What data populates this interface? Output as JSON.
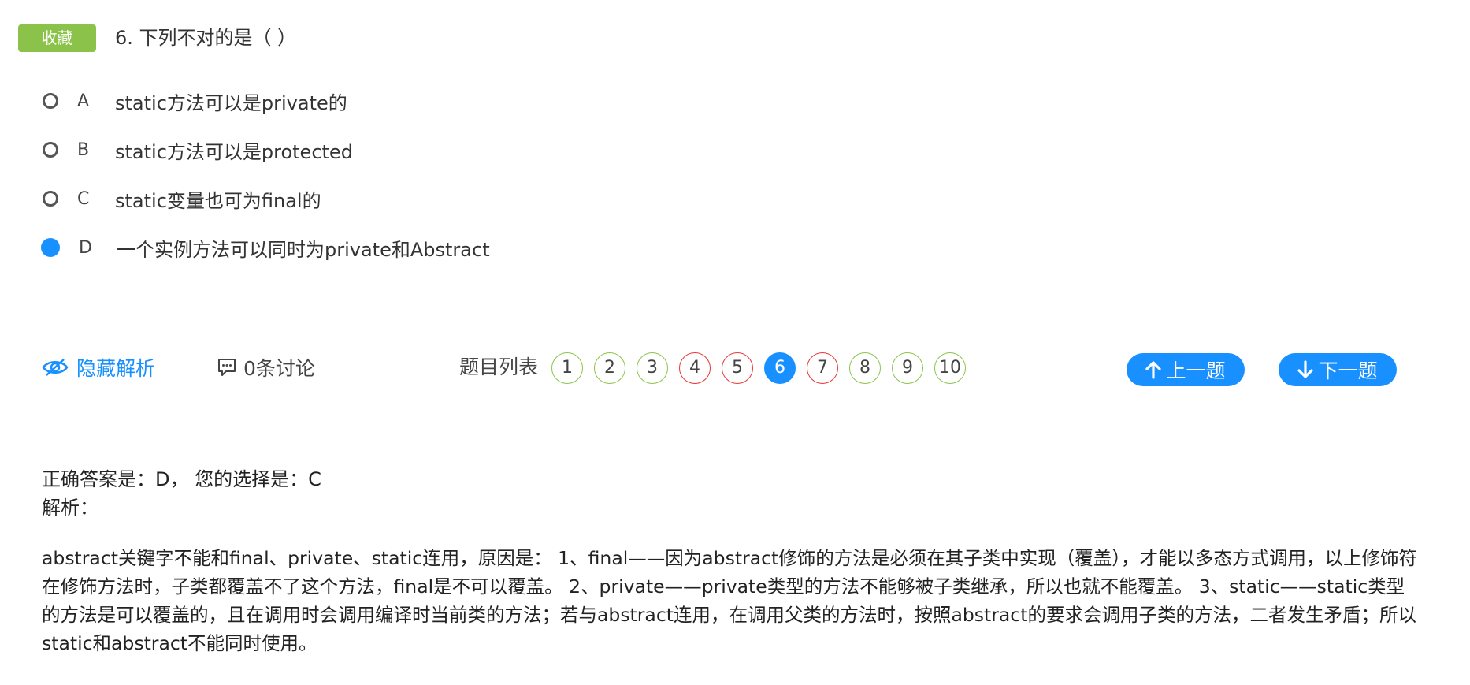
{
  "header": {
    "favorite_label": "收藏",
    "question_title": "6. 下列不对的是（ ）"
  },
  "options": [
    {
      "letter": "A",
      "text": "static方法可以是private的",
      "selected": false
    },
    {
      "letter": "B",
      "text": "static方法可以是protected",
      "selected": false
    },
    {
      "letter": "C",
      "text": "static变量也可为final的",
      "selected": false
    },
    {
      "letter": "D",
      "text": "一个实例方法可以同时为private和Abstract",
      "selected": true
    }
  ],
  "toolbar": {
    "hide_analysis_label": "隐藏解析",
    "discussion_label": "0条讨论",
    "question_list_label": "题目列表",
    "prev_label": "上一题",
    "next_label": "下一题"
  },
  "question_numbers": [
    {
      "num": "1",
      "status": "correct"
    },
    {
      "num": "2",
      "status": "correct"
    },
    {
      "num": "3",
      "status": "correct"
    },
    {
      "num": "4",
      "status": "wrong"
    },
    {
      "num": "5",
      "status": "wrong"
    },
    {
      "num": "6",
      "status": "current"
    },
    {
      "num": "7",
      "status": "wrong"
    },
    {
      "num": "8",
      "status": "correct"
    },
    {
      "num": "9",
      "status": "correct"
    },
    {
      "num": "10",
      "status": "correct"
    }
  ],
  "analysis": {
    "answer_line": "正确答案是：D，  您的选择是：C",
    "label": "解析：",
    "text": "abstract关键字不能和final、private、static连用，原因是： 1、final——因为abstract修饰的方法是必须在其子类中实现（覆盖），才能以多态方式调用，以上修饰符在修饰方法时，子类都覆盖不了这个方法，final是不可以覆盖。 2、private——private类型的方法不能够被子类继承，所以也就不能覆盖。 3、static——static类型的方法是可以覆盖的，且在调用时会调用编译时当前类的方法；若与abstract连用，在调用父类的方法时，按照abstract的要求会调用子类的方法，二者发生矛盾；所以static和abstract不能同时使用。"
  },
  "colors": {
    "accent": "#1890ff",
    "favorite_bg": "#8bc34a",
    "correct_border": "#8bc34a",
    "wrong_border": "#e53935"
  }
}
